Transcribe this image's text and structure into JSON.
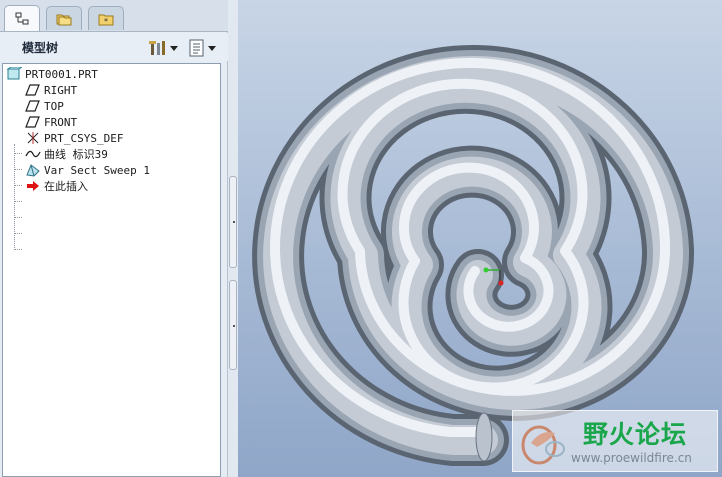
{
  "left_panel": {
    "title": "模型树",
    "tabs": [
      {
        "icon": "model-tree-tab-icon",
        "active": true
      },
      {
        "icon": "folder-browser-tab-icon",
        "active": false
      },
      {
        "icon": "favorites-tab-icon",
        "active": false
      }
    ],
    "header_buttons": [
      {
        "icon": "tree-settings-icon"
      },
      {
        "icon": "show-options-icon"
      }
    ]
  },
  "tree": {
    "root": {
      "label": "PRT0001.PRT",
      "icon": "part-icon"
    },
    "items": [
      {
        "label": "RIGHT",
        "icon": "datum-plane-icon"
      },
      {
        "label": "TOP",
        "icon": "datum-plane-icon"
      },
      {
        "label": "FRONT",
        "icon": "datum-plane-icon"
      },
      {
        "label": "PRT_CSYS_DEF",
        "icon": "coordinate-system-icon"
      },
      {
        "label": "曲线 标识39",
        "icon": "curve-icon"
      },
      {
        "label": "Var Sect Sweep 1",
        "icon": "sweep-feature-icon"
      },
      {
        "label": "在此插入",
        "icon": "insert-here-arrow-icon"
      }
    ]
  },
  "viewport": {
    "model": "spiral-sweep",
    "background_top": "#c8d5e6",
    "background_bottom": "#8fa6c8"
  },
  "watermark": {
    "title": "野火论坛",
    "url": "www.proewildfire.cn",
    "color": "#1aa64a"
  }
}
